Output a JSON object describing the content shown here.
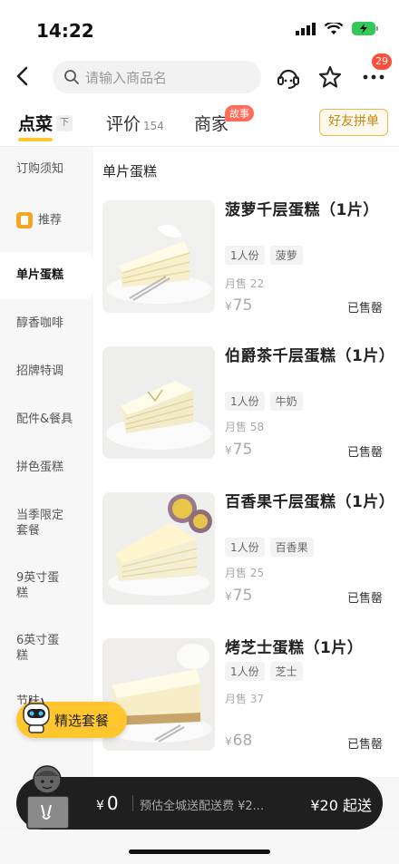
{
  "status_bar": {
    "time": "14:22"
  },
  "header": {
    "search_placeholder": "请输入商品名",
    "notification_count": "29"
  },
  "tabs": [
    {
      "label": "点菜",
      "sort_tag": "下"
    },
    {
      "label": "评价",
      "count": "154"
    },
    {
      "label": "商家",
      "badge": "故事"
    }
  ],
  "group_order_label": "好友拼单",
  "sidebar": {
    "items": [
      {
        "label": "订购须知"
      },
      {
        "label": "推荐"
      },
      {
        "label": "单片蛋糕"
      },
      {
        "label": "醇香咖啡"
      },
      {
        "label": "招牌特调"
      },
      {
        "label": "配件&餐具"
      },
      {
        "label": "拼色蛋糕"
      },
      {
        "label": "当季限定套餐"
      },
      {
        "label": "9英寸蛋糕"
      },
      {
        "label": "6英寸蛋糕"
      },
      {
        "label": "节味..."
      }
    ]
  },
  "main": {
    "section_title": "单片蛋糕",
    "products": [
      {
        "name": "菠萝千层蛋糕（1片）",
        "tags": [
          "1人份",
          "菠萝"
        ],
        "sold": "月售 22",
        "currency": "¥",
        "price": "75",
        "status": "已售罄"
      },
      {
        "name": "伯爵茶千层蛋糕（1片）",
        "tags": [
          "1人份",
          "牛奶"
        ],
        "sold": "月售 58",
        "currency": "¥",
        "price": "75",
        "status": "已售罄"
      },
      {
        "name": "百香果千层蛋糕（1片）",
        "tags": [
          "1人份",
          "百香果"
        ],
        "sold": "月售 25",
        "currency": "¥",
        "price": "75",
        "status": "已售罄"
      },
      {
        "name": "烤芝士蛋糕（1片）",
        "tags": [
          "1人份",
          "芝士"
        ],
        "sold": "月售 37",
        "currency": "¥",
        "price": "68",
        "status": "已售罄"
      }
    ]
  },
  "combo_button": "精选套餐",
  "cart": {
    "currency": "¥",
    "total": "0",
    "delivery_text": "预估全城送配送费 ¥2...",
    "min_order": "¥20 起送"
  },
  "colors": {
    "accent": "#ffc62e",
    "badge": "#ff4d3a",
    "cart_bar": "#1f1f1f"
  }
}
